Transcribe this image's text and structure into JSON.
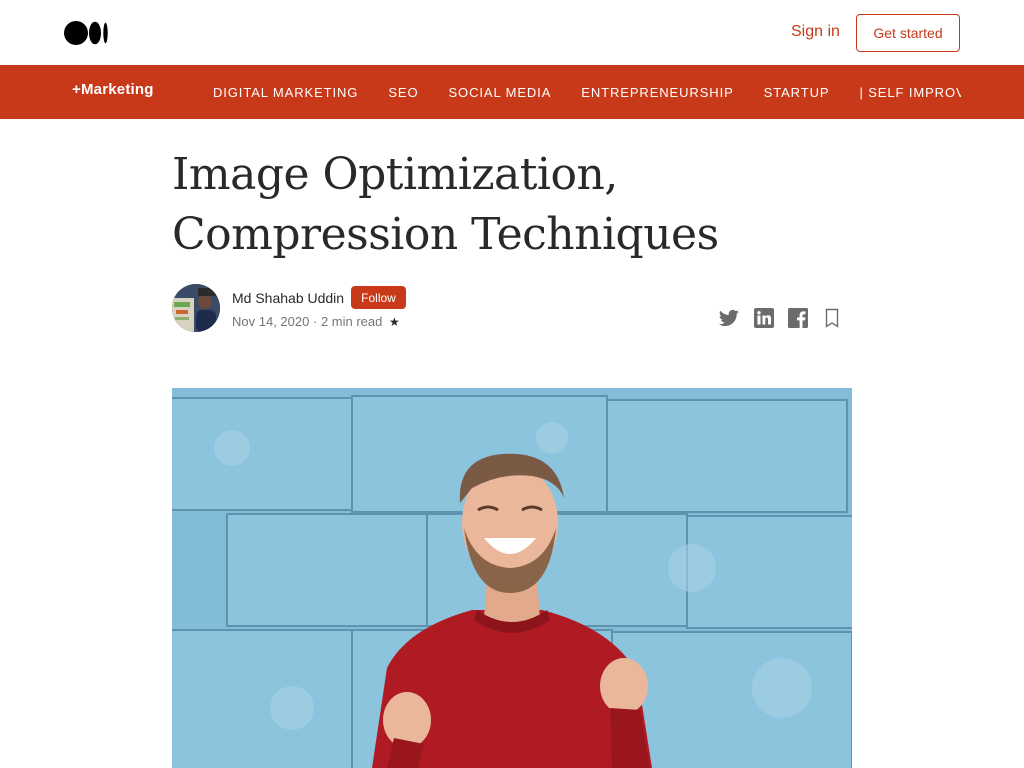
{
  "header": {
    "logo_icon": "medium-logo-icon",
    "signin_label": "Sign in",
    "get_started_label": "Get started",
    "accent_color": "#c8391a"
  },
  "publication": {
    "name": "+Marketing",
    "background_color": "#c8391a",
    "nav_items": [
      "DIGITAL MARKETING",
      "SEO",
      "SOCIAL MEDIA",
      "ENTREPRENEURSHIP",
      "STARTUP",
      "| SELF IMPROVEMENT"
    ]
  },
  "article": {
    "title": "Image Optimization, Compression Techniques",
    "author": "Md Shahab Uddin",
    "follow_label": "Follow",
    "date": "Nov 14, 2020",
    "separator": "·",
    "read_time": "2 min read",
    "member_star": "★",
    "share_icons": [
      "twitter-icon",
      "linkedin-icon",
      "facebook-icon",
      "bookmark-icon"
    ]
  },
  "hero_image": {
    "description_icon": "hero-photo"
  }
}
